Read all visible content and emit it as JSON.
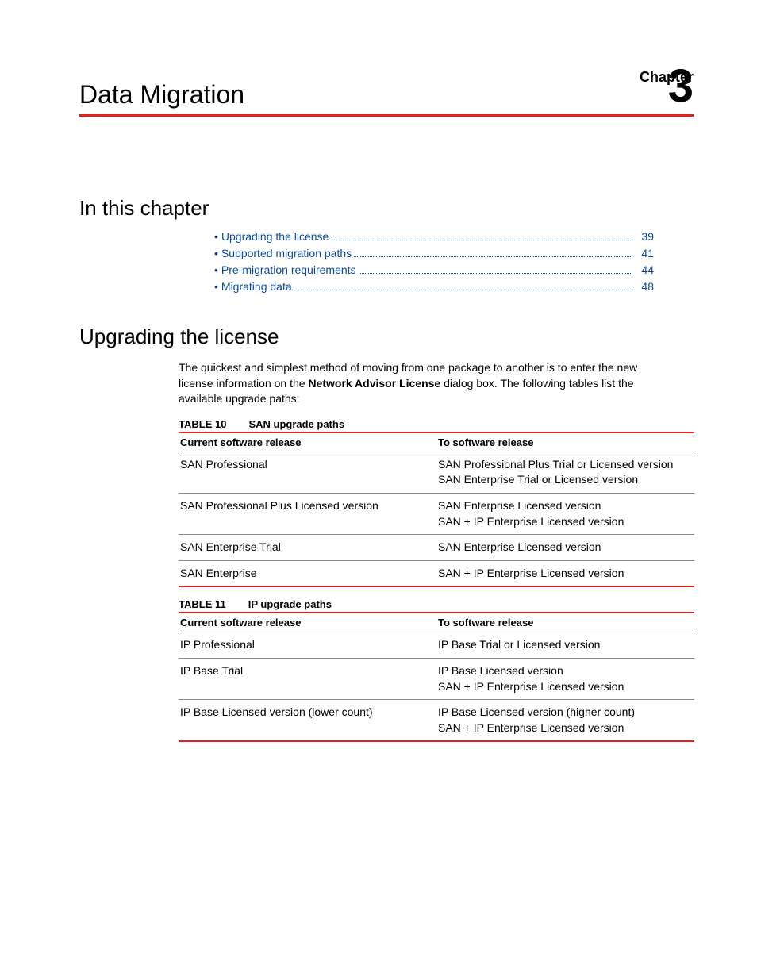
{
  "header": {
    "chapter_label": "Chapter",
    "chapter_number": "3",
    "title": "Data Migration"
  },
  "section1": {
    "heading": "In this chapter",
    "toc": [
      {
        "label": "Upgrading the license",
        "page": "39"
      },
      {
        "label": "Supported migration paths",
        "page": "41"
      },
      {
        "label": "Pre-migration requirements",
        "page": "44"
      },
      {
        "label": "Migrating data",
        "page": "48"
      }
    ]
  },
  "section2": {
    "heading": "Upgrading the license",
    "intro_pre": "The quickest and simplest method of moving from one package to another is to enter the new license information on the ",
    "intro_bold": "Network Advisor License",
    "intro_post": " dialog box. The following tables list the available upgrade paths:"
  },
  "table10": {
    "caption_num": "TABLE 10",
    "caption_title": "SAN upgrade paths",
    "col1": "Current software release",
    "col2": "To software release",
    "rows": [
      {
        "c1": "SAN Professional",
        "c2": "SAN Professional Plus Trial or Licensed version\nSAN Enterprise Trial or Licensed version"
      },
      {
        "c1": "SAN Professional Plus Licensed version",
        "c2": "SAN Enterprise Licensed version\nSAN + IP Enterprise Licensed version"
      },
      {
        "c1": "SAN Enterprise Trial",
        "c2": "SAN Enterprise Licensed version"
      },
      {
        "c1": "SAN Enterprise",
        "c2": "SAN + IP Enterprise Licensed version"
      }
    ]
  },
  "table11": {
    "caption_num": "TABLE 11",
    "caption_title": "IP upgrade paths",
    "col1": "Current software release",
    "col2": "To software release",
    "rows": [
      {
        "c1": "IP Professional",
        "c2": "IP Base Trial or Licensed version"
      },
      {
        "c1": "IP Base Trial",
        "c2": "IP Base Licensed version\nSAN + IP Enterprise Licensed version"
      },
      {
        "c1": "IP Base Licensed version (lower count)",
        "c2": "IP Base Licensed version (higher count)\nSAN + IP Enterprise Licensed version"
      }
    ]
  }
}
